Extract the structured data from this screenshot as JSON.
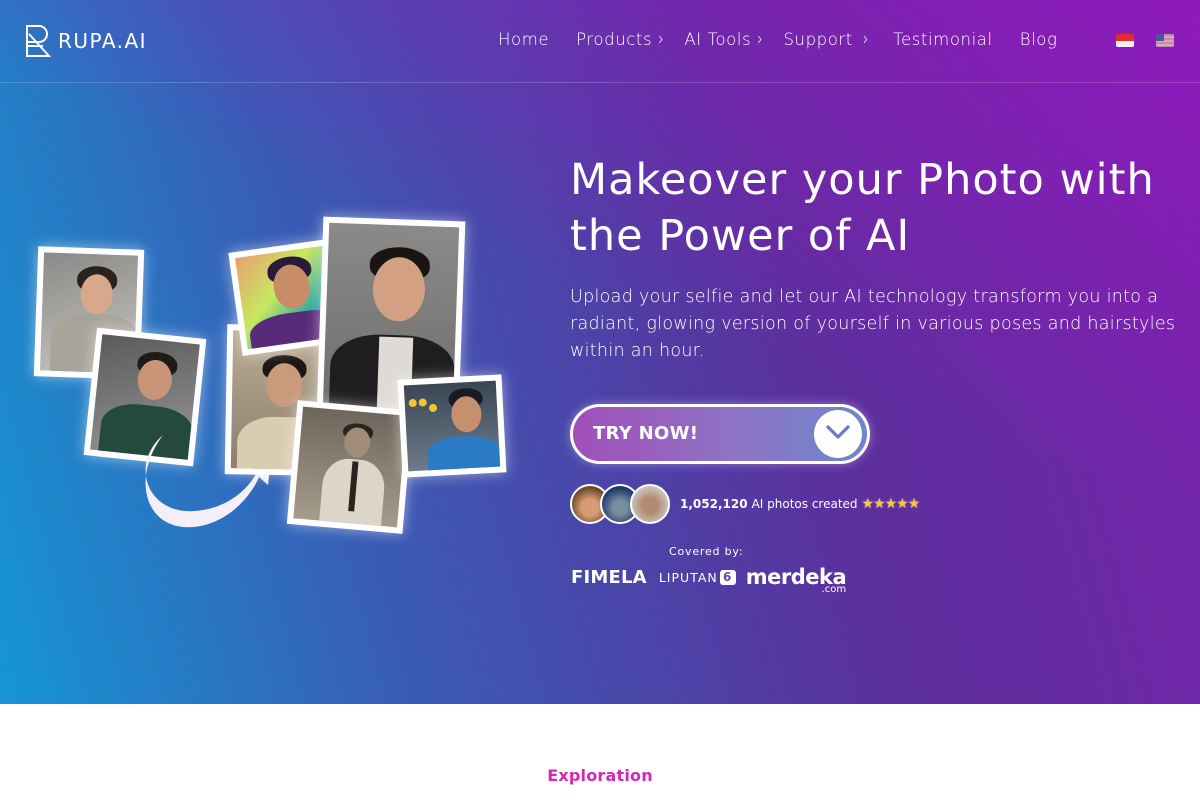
{
  "brand": {
    "name": "RUPA.AI",
    "logo_icon": "rupa-r-logo-icon"
  },
  "nav": {
    "items": [
      {
        "label": "Home",
        "has_submenu": false
      },
      {
        "label": "Products",
        "has_submenu": true
      },
      {
        "label": "AI Tools",
        "has_submenu": true
      },
      {
        "label": "Support",
        "has_submenu": true
      },
      {
        "label": "Testimonial",
        "has_submenu": false
      },
      {
        "label": "Blog",
        "has_submenu": false
      }
    ],
    "chevron_glyph": "›",
    "languages": [
      {
        "code": "id",
        "icon": "indonesia-flag-icon"
      },
      {
        "code": "en",
        "icon": "us-flag-icon"
      }
    ]
  },
  "hero": {
    "headline": "Makeover your Photo with the Power of AI",
    "subtext": "Upload your selfie and let our AI technology transform you into a radiant, glowing version of yourself in various poses and hairstyles within an hour.",
    "cta_label": "TRY NOW!",
    "cta_icon": "chevron-down-icon",
    "stats": {
      "count": "1,052,120",
      "label": "AI photos created",
      "stars": "★★★★★",
      "rating": 5
    },
    "covered_by_label": "Covered by:",
    "press": [
      {
        "name": "FIMELA"
      },
      {
        "name": "LIPUTAN",
        "suffix": "6"
      },
      {
        "name": "merdeka",
        "suffix": ".com"
      }
    ]
  },
  "next_section": {
    "eyebrow": "Exploration"
  },
  "colors": {
    "accent_pink": "#d626b8",
    "gradient_start": "#1596d2",
    "gradient_end": "#7a22ad",
    "cta_start": "#a14fb8",
    "cta_end": "#6d86cc"
  }
}
